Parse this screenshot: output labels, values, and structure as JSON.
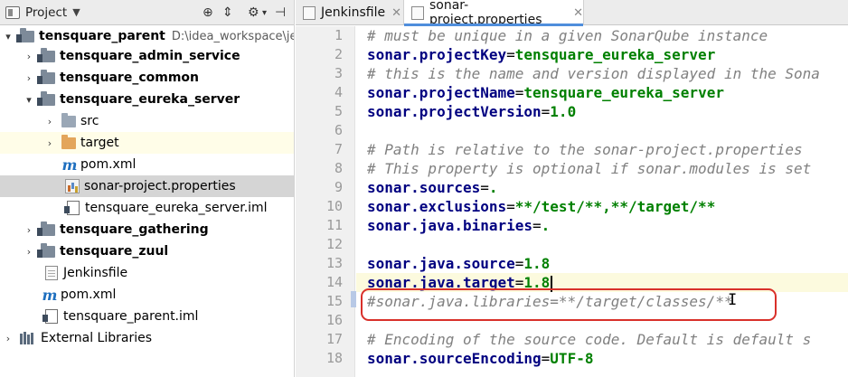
{
  "project_panel": {
    "title": "Project",
    "tree": [
      {
        "label": "tensquare_parent",
        "path": "D:\\idea_workspace\\jenk",
        "expanded": true,
        "icon": "module-folder-icon",
        "bold": true
      },
      {
        "label": "tensquare_admin_service",
        "expanded": false,
        "icon": "module-folder-icon",
        "bold": true
      },
      {
        "label": "tensquare_common",
        "expanded": false,
        "icon": "module-folder-icon",
        "bold": true
      },
      {
        "label": "tensquare_eureka_server",
        "expanded": true,
        "icon": "module-folder-icon",
        "bold": true
      },
      {
        "label": "src",
        "expanded": false,
        "icon": "folder-icon"
      },
      {
        "label": "target",
        "expanded": false,
        "icon": "excluded-folder-icon"
      },
      {
        "label": "pom.xml",
        "icon": "maven-icon"
      },
      {
        "label": "sonar-project.properties",
        "icon": "properties-file-icon",
        "selected": true
      },
      {
        "label": "tensquare_eureka_server.iml",
        "icon": "iml-file-icon"
      },
      {
        "label": "tensquare_gathering",
        "expanded": false,
        "icon": "module-folder-icon",
        "bold": true
      },
      {
        "label": "tensquare_zuul",
        "expanded": false,
        "icon": "module-folder-icon",
        "bold": true
      },
      {
        "label": "Jenkinsfile",
        "icon": "text-file-icon"
      },
      {
        "label": "pom.xml",
        "icon": "maven-icon"
      },
      {
        "label": "tensquare_parent.iml",
        "icon": "iml-file-icon"
      },
      {
        "label": "External Libraries",
        "expanded": false,
        "icon": "library-icon"
      }
    ]
  },
  "editor": {
    "tabs": [
      {
        "label": "Jenkinsfile",
        "active": false
      },
      {
        "label": "sonar-project.properties",
        "active": true
      }
    ],
    "lines": [
      {
        "n": "1",
        "type": "comment",
        "text": "# must be unique in a given SonarQube instance"
      },
      {
        "n": "2",
        "type": "kv",
        "key": "sonar.projectKey",
        "value": "tensquare_eureka_server"
      },
      {
        "n": "3",
        "type": "comment",
        "text": "# this is the name and version displayed in the Sona"
      },
      {
        "n": "4",
        "type": "kv",
        "key": "sonar.projectName",
        "value": "tensquare_eureka_server"
      },
      {
        "n": "5",
        "type": "kv",
        "key": "sonar.projectVersion",
        "value": "1.0"
      },
      {
        "n": "6",
        "type": "blank"
      },
      {
        "n": "7",
        "type": "comment",
        "text": "# Path is relative to the sonar-project.properties"
      },
      {
        "n": "8",
        "type": "comment",
        "text": "# This property is optional if sonar.modules is set"
      },
      {
        "n": "9",
        "type": "kv",
        "key": "sonar.sources",
        "value": "."
      },
      {
        "n": "10",
        "type": "kv",
        "key": "sonar.exclusions",
        "value": "**/test/**,**/target/**"
      },
      {
        "n": "11",
        "type": "kv",
        "key": "sonar.java.binaries",
        "value": "."
      },
      {
        "n": "12",
        "type": "blank"
      },
      {
        "n": "13",
        "type": "kv",
        "key": "sonar.java.source",
        "value": "1.8"
      },
      {
        "n": "14",
        "type": "kv",
        "key": "sonar.java.target",
        "value": "1.8",
        "current": true
      },
      {
        "n": "15",
        "type": "comment",
        "text": "#sonar.java.libraries=**/target/classes/**"
      },
      {
        "n": "16",
        "type": "blank"
      },
      {
        "n": "17",
        "type": "comment",
        "text": "# Encoding of the source code. Default is default s"
      },
      {
        "n": "18",
        "type": "kv",
        "key": "sonar.sourceEncoding",
        "value": "UTF-8"
      }
    ]
  },
  "colors": {
    "highlight_box": "#d9302a",
    "selected_row": "#d5d5d5",
    "comment": "#808080",
    "key": "#000080",
    "value": "#008000"
  }
}
